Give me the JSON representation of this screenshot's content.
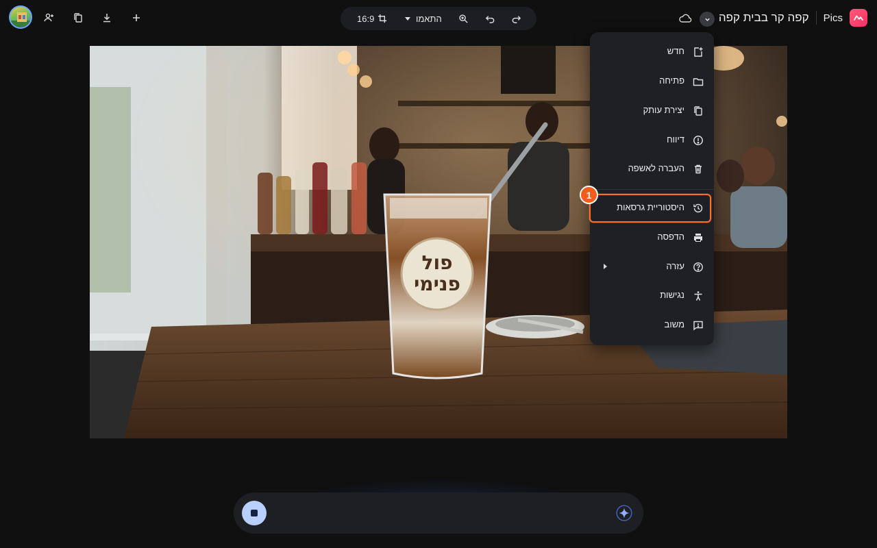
{
  "app": {
    "brand": "Pics",
    "document_title": "קפה קר בבית קפה",
    "accent": "#ff6f2c",
    "logo_color": "#ff2e63"
  },
  "toolbar": {
    "aspect_ratio": "16:9",
    "adjust_label": "התאמו",
    "icons": [
      "crop-icon",
      "dropdown-caret-icon",
      "zoom-icon",
      "undo-icon",
      "redo-icon"
    ]
  },
  "left_actions": {
    "icons": [
      "avatar",
      "share-user-icon",
      "copy-icon",
      "download-icon",
      "add-icon"
    ]
  },
  "menu": {
    "items": [
      {
        "label": "חדש",
        "icon": "new-file-icon"
      },
      {
        "label": "פתיחה",
        "icon": "folder-icon"
      },
      {
        "label": "יצירת עותק",
        "icon": "copy-icon"
      },
      {
        "label": "דיווח",
        "icon": "report-icon"
      },
      {
        "label": "העברה לאשפה",
        "icon": "trash-icon"
      },
      {
        "label": "היסטוריית גרסאות",
        "icon": "history-icon"
      },
      {
        "label": "הדפסה",
        "icon": "print-icon"
      },
      {
        "label": "עזרה",
        "icon": "help-icon"
      },
      {
        "label": "נגישות",
        "icon": "accessibility-icon"
      },
      {
        "label": "משוב",
        "icon": "feedback-icon"
      }
    ],
    "highlighted_index": 5,
    "badge_number": "1"
  },
  "photo": {
    "cup_label_line1": "פול",
    "cup_label_line2": "פנימי"
  },
  "prompt_bar": {
    "stop_icon": "stop-icon",
    "sparkle_icon": "sparkle-icon"
  }
}
